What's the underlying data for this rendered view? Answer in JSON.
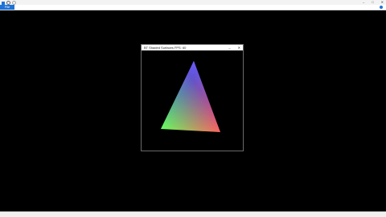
{
  "app": {
    "title": "",
    "window_controls": [
      "–",
      "□",
      "✕"
    ]
  },
  "ribbon": {
    "tabs": [
      "File",
      "",
      ""
    ]
  },
  "inner_window": {
    "title": "BT Shaded Surfaces FPS: 60",
    "controls": [
      "–",
      "✕"
    ],
    "triangle_colors": {
      "top": "#3a2bff",
      "left": "#1bff2a",
      "right": "#ff1a2a"
    }
  },
  "status": {
    "left": "",
    "right": ""
  },
  "colors": {
    "accent": "#1e73d8",
    "background": "#000000"
  }
}
